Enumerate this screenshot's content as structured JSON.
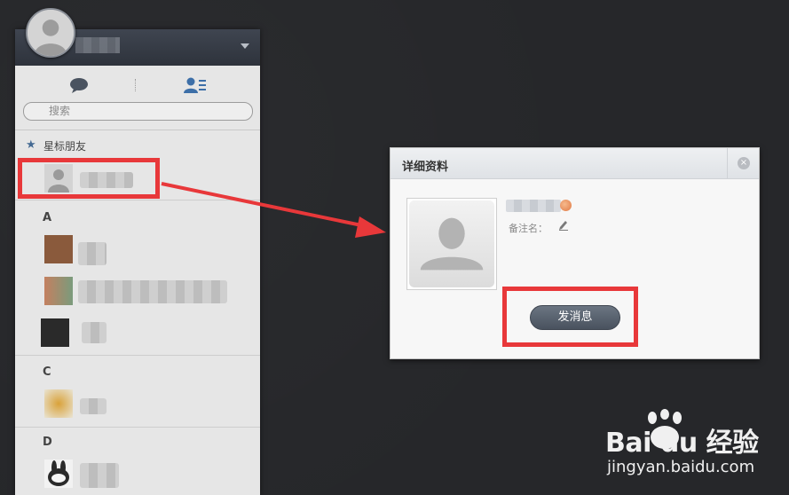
{
  "panel": {
    "search_placeholder": "搜索",
    "starred_group": "星标朋友",
    "sections": [
      "A",
      "C",
      "D"
    ]
  },
  "dialog": {
    "title": "详细资料",
    "remark_label": "备注名：",
    "send_button": "发消息",
    "close": "×"
  },
  "watermark": {
    "logo": "Bai du 经验",
    "url": "jingyan.baidu.com"
  },
  "colors": {
    "highlight": "#e8383a",
    "background": "#26272a",
    "header": "#3a3f48"
  }
}
